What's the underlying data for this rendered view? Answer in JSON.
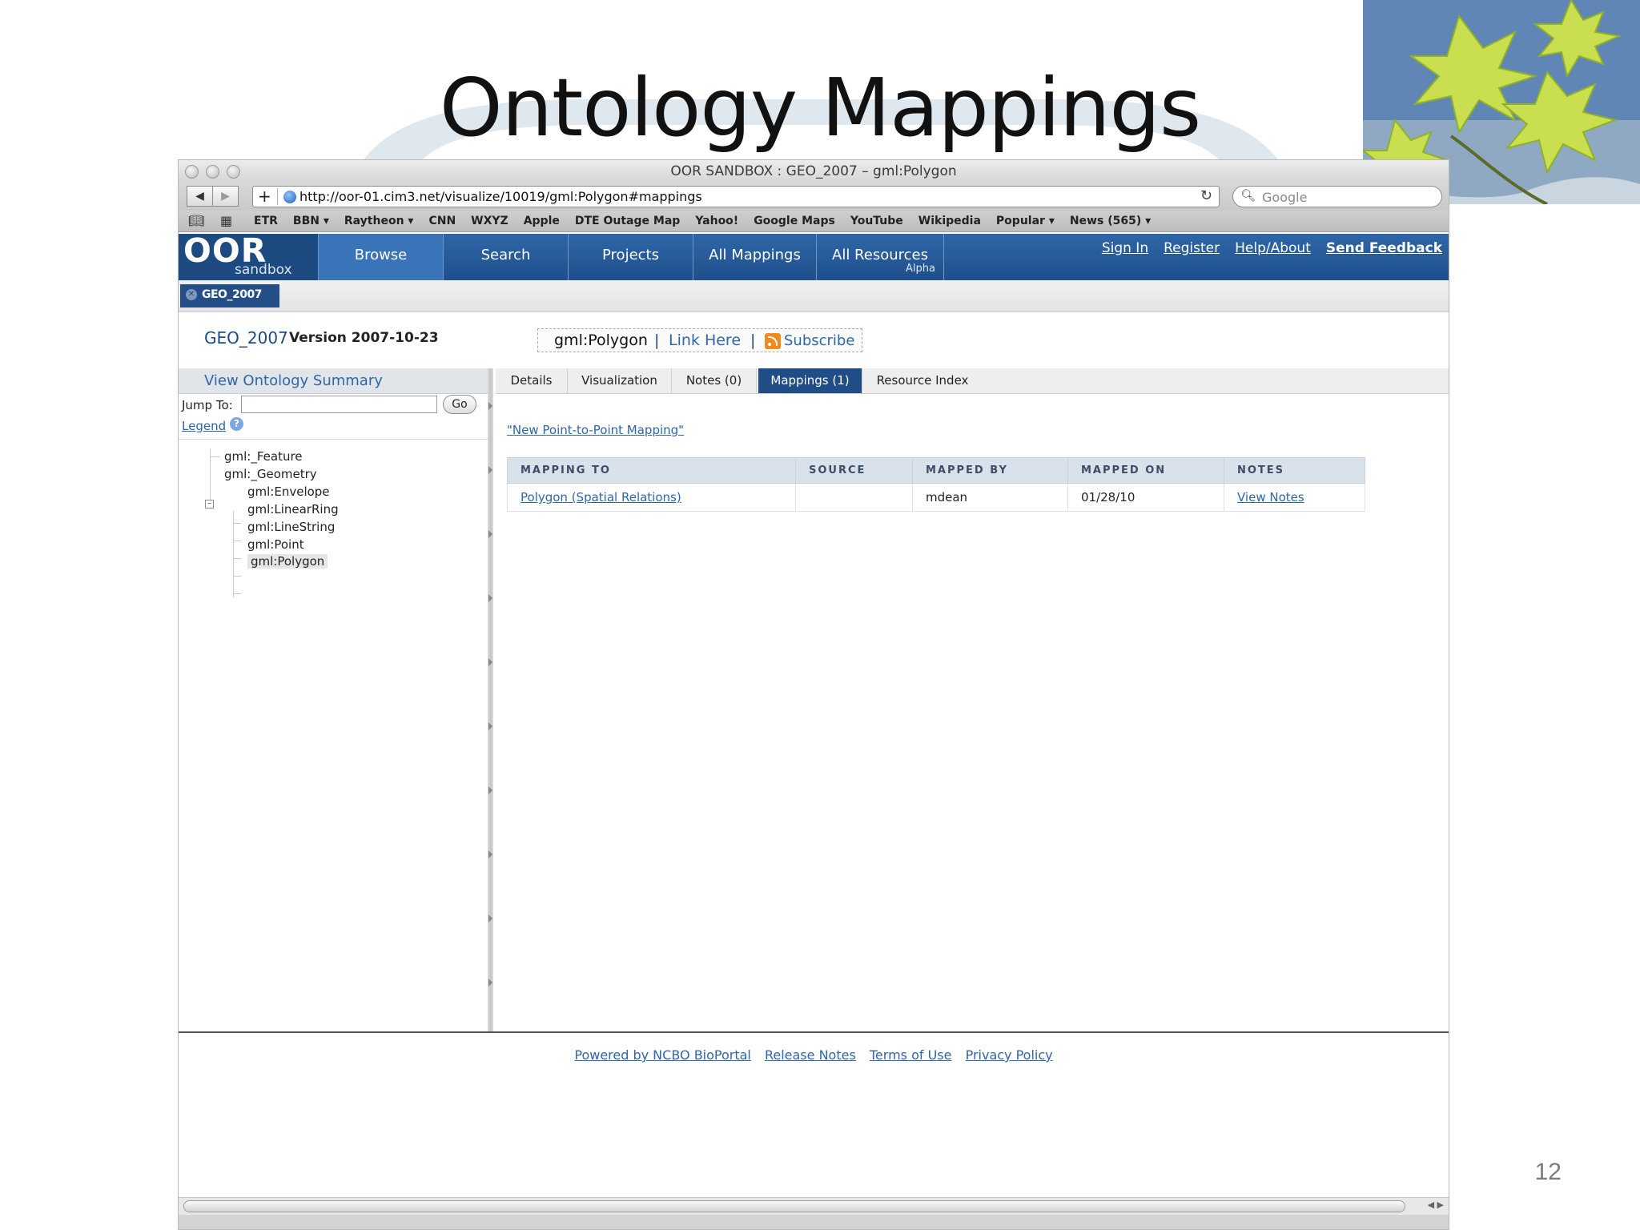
{
  "slide": {
    "title": "Ontology Mappings",
    "page_number": "12"
  },
  "browser": {
    "window_title": "OOR SANDBOX : GEO_2007 – gml:Polygon",
    "url": "http://oor-01.cim3.net/visualize/10019/gml:Polygon#mappings",
    "search_placeholder": "Google",
    "bookmarks": [
      "ETR",
      "BBN ▾",
      "Raytheon ▾",
      "CNN",
      "WXYZ",
      "Apple",
      "DTE Outage Map",
      "Yahoo!",
      "Google Maps",
      "YouTube",
      "Wikipedia",
      "Popular ▾",
      "News (565) ▾"
    ]
  },
  "site": {
    "logo": "OOR",
    "logo_sub": "sandbox",
    "nav": [
      "Browse",
      "Search",
      "Projects",
      "All Mappings",
      "All Resources"
    ],
    "nav_badge": "Alpha",
    "top_links": [
      "Sign In",
      "Register",
      "Help/About",
      "Send Feedback"
    ],
    "crumb": "GEO_2007"
  },
  "ontology": {
    "name": "GEO_2007",
    "version": "Version 2007-10-23",
    "term": "gml:Polygon",
    "sep": "|",
    "link_here": "Link Here",
    "subscribe": "Subscribe"
  },
  "tree_panel": {
    "summary": "View Ontology Summary",
    "jump_label": "Jump To:",
    "go": "Go",
    "legend": "Legend",
    "legend_icon": "?",
    "nodes": {
      "feature": "gml:_Feature",
      "geometry": "gml:_Geometry",
      "envelope": "gml:Envelope",
      "linearring": "gml:LinearRing",
      "linestring": "gml:LineString",
      "point": "gml:Point",
      "polygon": "gml:Polygon"
    }
  },
  "tabs": [
    "Details",
    "Visualization",
    "Notes (0)",
    "Mappings (1)",
    "Resource Index"
  ],
  "mappings": {
    "new_link": "\"New Point-to-Point Mapping\"",
    "headers": [
      "MAPPING TO",
      "SOURCE",
      "MAPPED BY",
      "MAPPED ON",
      "NOTES"
    ],
    "rows": [
      {
        "mapping_to": "Polygon (Spatial Relations)",
        "source": "",
        "mapped_by": "mdean",
        "mapped_on": "01/28/10",
        "notes": "View Notes"
      }
    ]
  },
  "footer": [
    "Powered by NCBO BioPortal",
    "Release Notes",
    "Terms of Use",
    "Privacy Policy"
  ],
  "colors": {
    "nav_blue": "#2f66a8",
    "active_tab": "#214d87",
    "link": "#2f66a8"
  }
}
